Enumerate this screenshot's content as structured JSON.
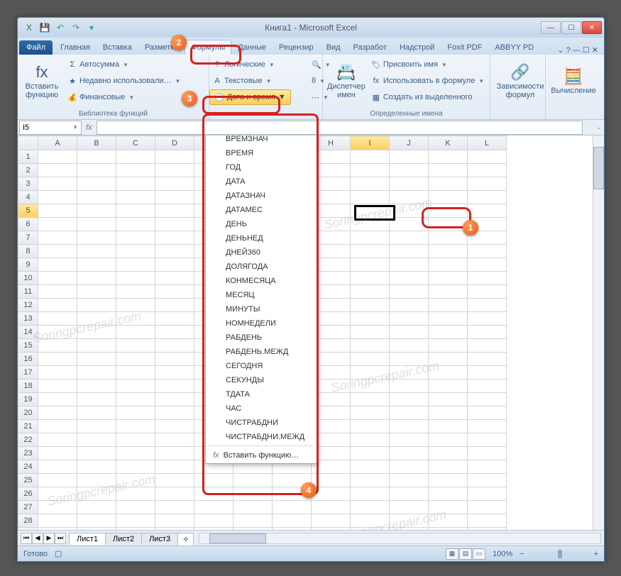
{
  "window": {
    "title": "Книга1 - Microsoft Excel",
    "controls": {
      "min": "—",
      "max": "☐",
      "close": "✕"
    }
  },
  "qat": {
    "excel": "X",
    "save": "💾",
    "undo": "↶",
    "redo": "↷"
  },
  "tabs": {
    "file": "Файл",
    "items": [
      "Главная",
      "Вставка",
      "Разметка",
      "Формулы",
      "Данные",
      "Рецензир",
      "Вид",
      "Разработ",
      "Надстрой",
      "Foxit PDF",
      "ABBYY PD"
    ],
    "active_index": 3,
    "help": "⌄   ?   —  ☐  ✕"
  },
  "ribbon": {
    "insert_fn": {
      "label": "Вставить\nфункцию",
      "icon": "fx"
    },
    "group1_label": "Библиотека функций",
    "autosum": "Автосумма",
    "recent": "Недавно использовали…",
    "financial": "Финансовые",
    "logical": "Логические",
    "text": "Текстовые",
    "date_time": "Дата и время",
    "lookup_icon": "🔍",
    "math_icon": "θ",
    "more_icon": "⋯",
    "name_mgr": {
      "label": "Диспетчер\nимен",
      "icon": "📇"
    },
    "assign_name": "Присвоить имя",
    "use_in_formula": "Использовать в формуле",
    "create_from_sel": "Создать из выделенного",
    "group2_label": "Определенные имена",
    "deps": {
      "label": "Зависимости\nформул",
      "icon": "🔗"
    },
    "calc": {
      "label": "Вычисление",
      "icon": "🧮"
    }
  },
  "namebox": {
    "value": "I5"
  },
  "columns": [
    "A",
    "B",
    "C",
    "D",
    "E",
    "F",
    "G",
    "H",
    "I",
    "J",
    "K",
    "L"
  ],
  "rows_count": 30,
  "selected": {
    "col": "I",
    "row": 5
  },
  "dropdown": {
    "items": [
      "ВРЕМЗНАЧ",
      "ВРЕМЯ",
      "ГОД",
      "ДАТА",
      "ДАТАЗНАЧ",
      "ДАТАМЕС",
      "ДЕНЬ",
      "ДЕНЬНЕД",
      "ДНЕЙ360",
      "ДОЛЯГОДА",
      "КОНМЕСЯЦА",
      "МЕСЯЦ",
      "МИНУТЫ",
      "НОМНЕДЕЛИ",
      "РАБДЕНЬ",
      "РАБДЕНЬ.МЕЖД",
      "СЕГОДНЯ",
      "СЕКУНДЫ",
      "ТДАТА",
      "ЧАС",
      "ЧИСТРАБДНИ",
      "ЧИСТРАБДНИ.МЕЖД"
    ],
    "insert_fn": "Вставить функцию…"
  },
  "sheets": {
    "tabs": [
      "Лист1",
      "Лист2",
      "Лист3"
    ],
    "active": 0
  },
  "status": {
    "ready": "Готово",
    "zoom": "100%",
    "zoom_minus": "−",
    "zoom_plus": "+"
  },
  "watermark": "Soringpcrepair.com",
  "annotations": {
    "1": "1",
    "2": "2",
    "3": "3",
    "4": "4"
  }
}
